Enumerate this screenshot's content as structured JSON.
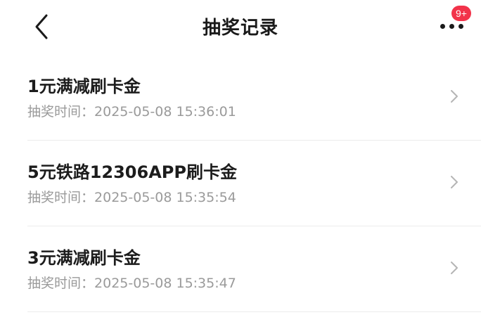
{
  "header": {
    "back_icon": "chevron-left-icon",
    "title": "抽奖记录",
    "more_icon": "more-horizontal-icon",
    "badge": "9+",
    "badge_color": "#f2334a"
  },
  "records": [
    {
      "title": "1元满减刷卡金",
      "time_label": "抽奖时间：",
      "time": "2025-05-08 15:36:01"
    },
    {
      "title": "5元铁路12306APP刷卡金",
      "time_label": "抽奖时间：",
      "time": "2025-05-08 15:35:54"
    },
    {
      "title": "3元满减刷卡金",
      "time_label": "抽奖时间：",
      "time": "2025-05-08 15:35:47"
    }
  ]
}
